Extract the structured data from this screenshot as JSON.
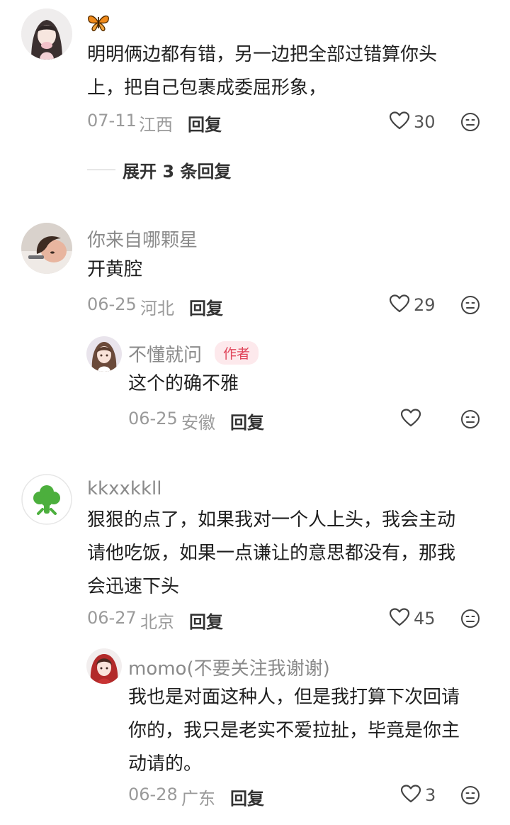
{
  "comments": [
    {
      "name": "",
      "badge_icon": "butterfly-icon",
      "content_lines": [
        "明明俩边都有错，另一边把全部过错算你头",
        "上，把自己包裹成委屈形象，"
      ],
      "date": "07-11",
      "location": "江西",
      "reply_label": "回复",
      "likes": "30",
      "expand_label": "展开 3 条回复"
    },
    {
      "name": "你来自哪颗星",
      "content_lines": [
        "开黄腔"
      ],
      "date": "06-25",
      "location": "河北",
      "reply_label": "回复",
      "likes": "29",
      "sub_reply": {
        "name": "不懂就问",
        "badge": "作者",
        "content_lines": [
          "这个的确不雅"
        ],
        "date": "06-25",
        "location": "安徽",
        "reply_label": "回复",
        "likes": ""
      }
    },
    {
      "name": "kkxxkkll",
      "content_lines": [
        "狠狠的点了，如果我对一个人上头，我会主动",
        "请他吃饭，如果一点谦让的意思都没有，那我",
        "会迅速下头"
      ],
      "date": "06-27",
      "location": "北京",
      "reply_label": "回复",
      "likes": "45",
      "sub_reply": {
        "name": "momo(不要关注我谢谢)",
        "content_lines": [
          "我也是对面这种人，但是我打算下次回请",
          "你的，我只是老实不爱拉扯，毕竟是你主",
          "动请的。"
        ],
        "date": "06-28",
        "location": "广东",
        "reply_label": "回复",
        "likes": "3"
      }
    }
  ],
  "colors": {
    "author_badge_text": "#e0455a",
    "author_badge_bg": "#fde9ec",
    "broccoli_green": "#4caf3d"
  }
}
